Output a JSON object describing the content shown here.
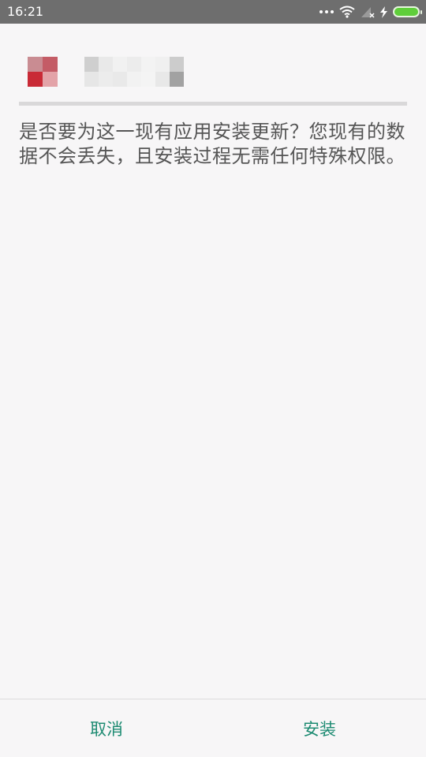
{
  "status_bar": {
    "time": "16:21",
    "icons": [
      "more-dots-icon",
      "wifi-icon",
      "signal-no-sim-icon",
      "charging-icon",
      "battery-icon"
    ],
    "battery_color": "#5fce3a"
  },
  "installer": {
    "app_icon": "app-icon-pixelated",
    "message": "是否要为这一现有应用安装更新？您现有的数据不会丢失，且安装过程无需任何特殊权限。"
  },
  "actions": {
    "cancel_label": "取消",
    "install_label": "安装",
    "accent_color": "#1d8b72"
  }
}
